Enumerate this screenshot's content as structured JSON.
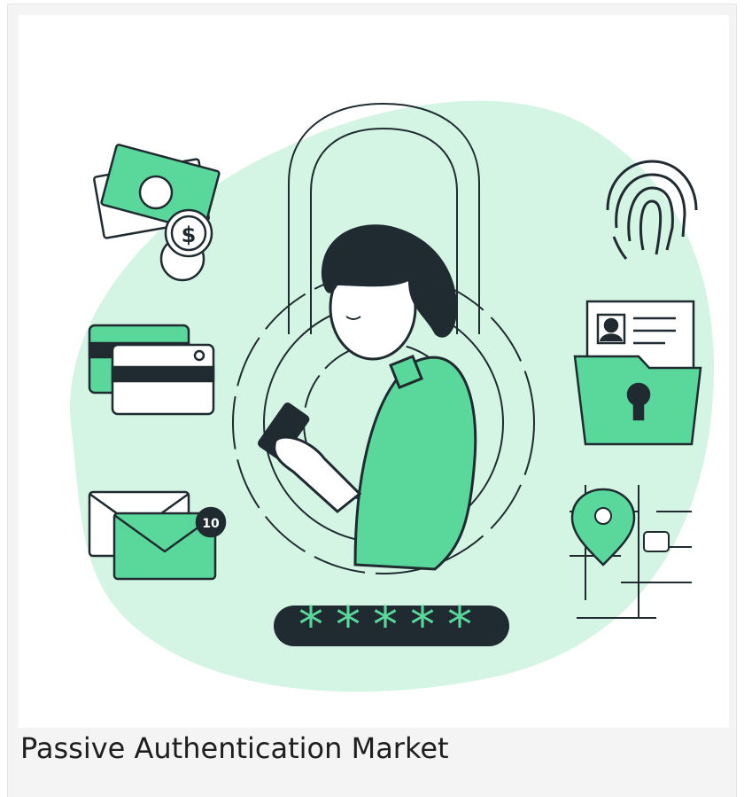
{
  "caption": "Passive Authentication Market",
  "colors": {
    "accent": "#5ad89c",
    "blob": "#d4f4e4",
    "ink": "#1f2b30",
    "background": "#f4f4f4"
  },
  "illustration": {
    "password_mask": "*****",
    "notification_count": "10",
    "icons": [
      "money-icon",
      "coin-icon",
      "credit-card-icon",
      "envelope-icon",
      "padlock-icon",
      "person-with-phone",
      "fingerprint-icon",
      "locked-folder-icon",
      "map-pin-icon"
    ]
  }
}
